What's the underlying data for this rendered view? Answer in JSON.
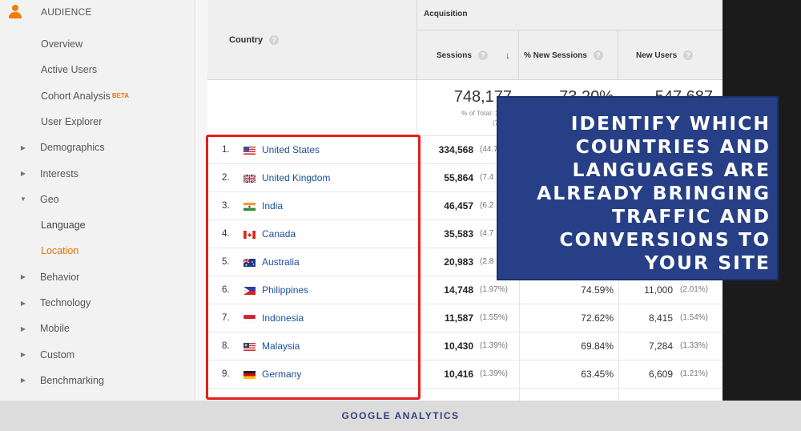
{
  "sidebar": {
    "section_label": "AUDIENCE",
    "items": [
      {
        "label": "Overview",
        "arrow": "",
        "kind": "child"
      },
      {
        "label": "Active Users",
        "arrow": "",
        "kind": "child"
      },
      {
        "label": "Cohort Analysis",
        "arrow": "",
        "kind": "child",
        "badge": "BETA"
      },
      {
        "label": "User Explorer",
        "arrow": "",
        "kind": "child"
      },
      {
        "label": "Demographics",
        "arrow": "▶",
        "kind": "parent"
      },
      {
        "label": "Interests",
        "arrow": "▶",
        "kind": "parent"
      },
      {
        "label": "Geo",
        "arrow": "▼",
        "kind": "parent"
      },
      {
        "label": "Language",
        "arrow": "",
        "kind": "child sub"
      },
      {
        "label": "Location",
        "arrow": "",
        "kind": "child active"
      },
      {
        "label": "Behavior",
        "arrow": "▶",
        "kind": "parent"
      },
      {
        "label": "Technology",
        "arrow": "▶",
        "kind": "parent"
      },
      {
        "label": "Mobile",
        "arrow": "▶",
        "kind": "parent"
      },
      {
        "label": "Custom",
        "arrow": "▶",
        "kind": "parent"
      },
      {
        "label": "Benchmarking",
        "arrow": "▶",
        "kind": "parent"
      }
    ]
  },
  "table": {
    "country_header": "Country",
    "group_header": "Acquisition",
    "columns": [
      "Sessions",
      "% New Sessions",
      "New Users"
    ],
    "sort_icon": "↓",
    "help_glyph": "?",
    "totals": {
      "sessions": "748,177",
      "sessions_sub1": "% of Total: 100.0",
      "sessions_sub2": "(748,1",
      "new_sessions": "73.20%",
      "new_users": "547,687"
    },
    "rows": [
      {
        "num": "1.",
        "country": "United States",
        "flag": "us",
        "sessions": "334,568",
        "sessions_pct": "(44.7",
        "new_sessions": "",
        "new_users": "",
        "new_users_pct": ""
      },
      {
        "num": "2.",
        "country": "United Kingdom",
        "flag": "gb",
        "sessions": "55,864",
        "sessions_pct": "(7.4",
        "new_sessions": "",
        "new_users": "",
        "new_users_pct": ""
      },
      {
        "num": "3.",
        "country": "India",
        "flag": "in",
        "sessions": "46,457",
        "sessions_pct": "(6.2",
        "new_sessions": "",
        "new_users": "",
        "new_users_pct": ""
      },
      {
        "num": "4.",
        "country": "Canada",
        "flag": "ca",
        "sessions": "35,583",
        "sessions_pct": "(4.7",
        "new_sessions": "",
        "new_users": "",
        "new_users_pct": ""
      },
      {
        "num": "5.",
        "country": "Australia",
        "flag": "au",
        "sessions": "20,983",
        "sessions_pct": "(2.8",
        "new_sessions": "",
        "new_users": "",
        "new_users_pct": ""
      },
      {
        "num": "6.",
        "country": "Philippines",
        "flag": "ph",
        "sessions": "14,748",
        "sessions_pct": "(1.97%)",
        "new_sessions": "74.59%",
        "new_users": "11,000",
        "new_users_pct": "(2.01%)"
      },
      {
        "num": "7.",
        "country": "Indonesia",
        "flag": "id",
        "sessions": "11,587",
        "sessions_pct": "(1.55%)",
        "new_sessions": "72.62%",
        "new_users": "8,415",
        "new_users_pct": "(1.54%)"
      },
      {
        "num": "8.",
        "country": "Malaysia",
        "flag": "my",
        "sessions": "10,430",
        "sessions_pct": "(1.39%)",
        "new_sessions": "69.84%",
        "new_users": "7,284",
        "new_users_pct": "(1.33%)"
      },
      {
        "num": "9.",
        "country": "Germany",
        "flag": "de",
        "sessions": "10,416",
        "sessions_pct": "(1.39%)",
        "new_sessions": "63.45%",
        "new_users": "6,609",
        "new_users_pct": "(1.21%)"
      }
    ]
  },
  "callout": {
    "text": "IDENTIFY WHICH\nCOUNTRIES AND\nLANGUAGES ARE\nALREADY BRINGING\nTRAFFIC AND\nCONVERSIONS TO\nYOUR SITE",
    "bg_color": "#263f86"
  },
  "highlight_color": "#e0201e",
  "footer": {
    "label": "GOOGLE ANALYTICS"
  }
}
